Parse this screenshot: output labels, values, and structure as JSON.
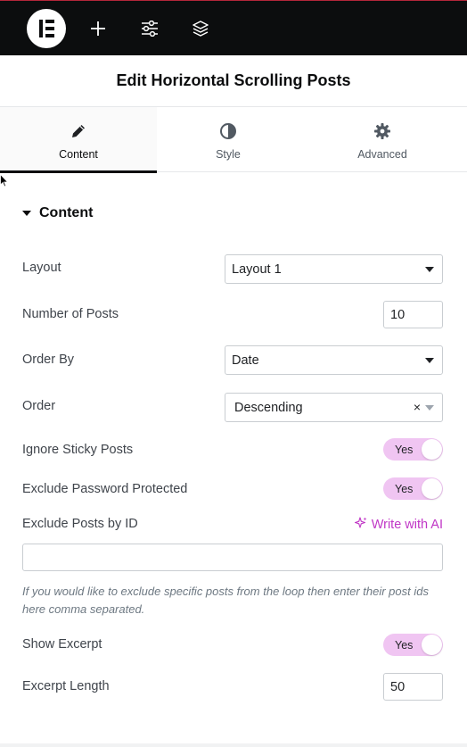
{
  "topbar": {
    "logo_icon": "elementor-logo",
    "add_icon": "plus-icon",
    "settings_icon": "sliders-icon",
    "structure_icon": "layers-icon"
  },
  "panel": {
    "title": "Edit Horizontal Scrolling Posts"
  },
  "tabs": [
    {
      "label": "Content",
      "icon": "pencil-icon",
      "active": true
    },
    {
      "label": "Style",
      "icon": "half-circle-icon",
      "active": false
    },
    {
      "label": "Advanced",
      "icon": "gear-icon",
      "active": false
    }
  ],
  "section": {
    "title": "Content",
    "expanded": true
  },
  "controls": {
    "layout": {
      "label": "Layout",
      "value": "Layout 1"
    },
    "number_of_posts": {
      "label": "Number of Posts",
      "value": "10"
    },
    "order_by": {
      "label": "Order By",
      "value": "Date"
    },
    "order": {
      "label": "Order",
      "value": "Descending",
      "clear": "×"
    },
    "ignore_sticky": {
      "label": "Ignore Sticky Posts",
      "value": "Yes"
    },
    "exclude_password": {
      "label": "Exclude Password Protected",
      "value": "Yes"
    },
    "exclude_ids": {
      "label": "Exclude Posts by ID",
      "ai_label": "Write with AI",
      "value": "",
      "help": "If you would like to exclude specific posts from the loop then enter their post ids here comma separated."
    },
    "show_excerpt": {
      "label": "Show Excerpt",
      "value": "Yes"
    },
    "excerpt_length": {
      "label": "Excerpt Length",
      "value": "50"
    }
  },
  "colors": {
    "topbar_bg": "#0c0d0e",
    "toggle_on": "#f0c5f2",
    "ai_accent": "#c036c6"
  }
}
